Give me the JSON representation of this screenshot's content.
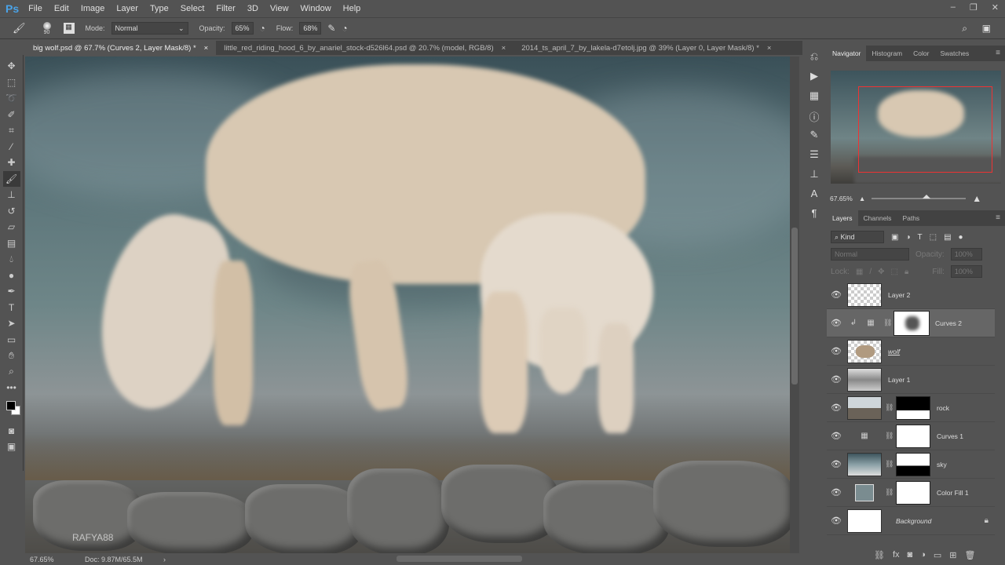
{
  "app": {
    "logo": "Ps",
    "menu": [
      "File",
      "Edit",
      "Image",
      "Layer",
      "Type",
      "Select",
      "Filter",
      "3D",
      "View",
      "Window",
      "Help"
    ]
  },
  "options": {
    "brush_size": "90",
    "mode_label": "Mode:",
    "mode_value": "Normal",
    "opacity_label": "Opacity:",
    "opacity_value": "65%",
    "flow_label": "Flow:",
    "flow_value": "68%"
  },
  "tabs": [
    {
      "label": "big wolf.psd @ 67.7% (Curves 2, Layer Mask/8) *",
      "close": "×"
    },
    {
      "label": "little_red_riding_hood_6_by_anariel_stock-d526l64.psd @ 20.7% (model, RGB/8)",
      "close": "×"
    },
    {
      "label": "2014_ts_april_7_by_lakela-d7etolj.jpg @ 39% (Layer 0, Layer Mask/8) *",
      "close": "×"
    }
  ],
  "canvas": {
    "watermark": "RAFYA88"
  },
  "status": {
    "zoom": "67.65%",
    "doc": "Doc: 9.87M/65.5M"
  },
  "navigator": {
    "tabs": [
      "Navigator",
      "Histogram",
      "Color",
      "Swatches"
    ],
    "zoom": "67.65%"
  },
  "layers_panel": {
    "tabs": [
      "Layers",
      "Channels",
      "Paths"
    ],
    "kind": "Kind",
    "blend": "Normal",
    "opacity_label": "Opacity:",
    "opacity": "100%",
    "lock_label": "Lock:",
    "fill_label": "Fill:",
    "fill": "100%",
    "layers": [
      {
        "name": "Layer 2"
      },
      {
        "name": "Curves 2"
      },
      {
        "name": "wolf"
      },
      {
        "name": "Layer 1"
      },
      {
        "name": "rock"
      },
      {
        "name": "Curves 1"
      },
      {
        "name": "sky"
      },
      {
        "name": "Color Fill 1"
      },
      {
        "name": "Background"
      }
    ]
  }
}
